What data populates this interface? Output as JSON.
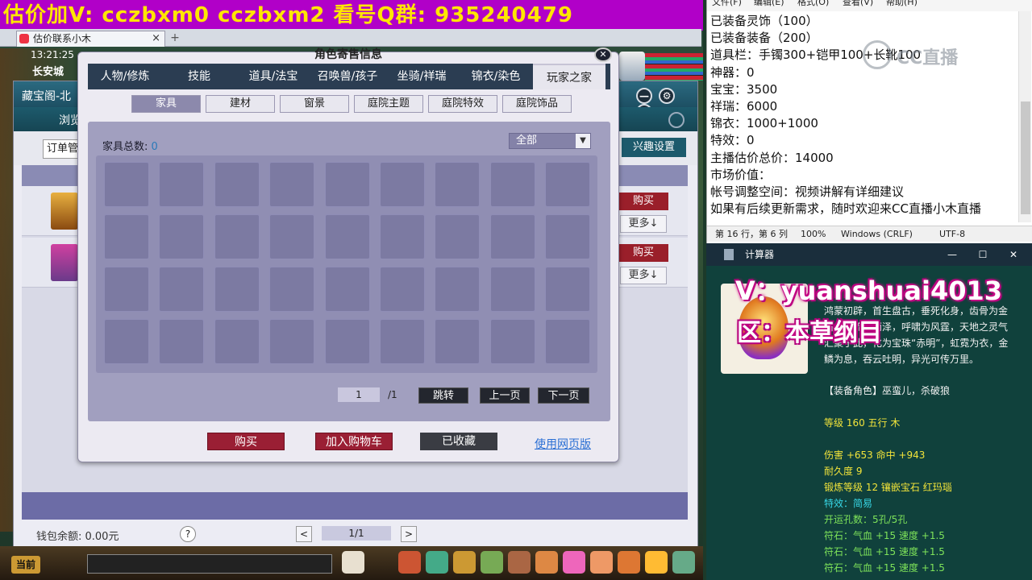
{
  "banner": {
    "text": "估价加V:    cczbxm0    cczbxm2    看号Q群: 935240479"
  },
  "browser": {
    "tab_title": "估价联系小木",
    "tab_close": "×",
    "tab_add": "+"
  },
  "hud": {
    "time": "13:21:25",
    "city": "长安城"
  },
  "store": {
    "title": "藏宝阁-北",
    "nav_browse": "浏览",
    "order_button": "订单管",
    "interest_button": "兴趣设置",
    "rows": [
      {
        "buy": "购买",
        "more": "更多↓"
      },
      {
        "buy": "购买",
        "more": "更多↓"
      }
    ],
    "wallet": "钱包余额: 0.00元",
    "help": "?",
    "pager": {
      "prev": "<",
      "value": "1/1",
      "next": ">"
    },
    "window_controls": {
      "min": "—",
      "settings": "⚙",
      "close": "✕"
    }
  },
  "dialog": {
    "title": "角色寄售信息",
    "close": "✕",
    "tabs": [
      {
        "label": "人物/修炼",
        "active": false
      },
      {
        "label": "技能",
        "active": false
      },
      {
        "label": "道具/法宝",
        "active": false
      },
      {
        "label": "召唤兽/孩子",
        "active": false
      },
      {
        "label": "坐骑/祥瑞",
        "active": false
      },
      {
        "label": "锦衣/染色",
        "active": false
      },
      {
        "label": "玩家之家",
        "active": true
      }
    ],
    "subtabs": [
      {
        "label": "家具",
        "active": true
      },
      {
        "label": "建材",
        "active": false
      },
      {
        "label": "窗景",
        "active": false
      },
      {
        "label": "庭院主题",
        "active": false
      },
      {
        "label": "庭院特效",
        "active": false
      },
      {
        "label": "庭院饰品",
        "active": false
      }
    ],
    "count_label": "家具总数:",
    "count_value": "0",
    "filter_value": "全部",
    "page_input": "1",
    "page_total": "/1",
    "jump_button": "跳转",
    "prev_button": "上一页",
    "next_button": "下一页",
    "buy_button": "购买",
    "cart_button": "加入购物车",
    "collected_button": "已收藏",
    "web_link": "使用网页版"
  },
  "bottom_bar": {
    "current_button": "当前"
  },
  "notepad": {
    "menu": [
      "文件(F)",
      "编辑(E)",
      "格式(O)",
      "查看(V)",
      "帮助(H)"
    ],
    "lines": [
      "已装备灵饰（100）",
      "已装备装备（200）",
      "道具栏：手镯300+铠甲100+长靴100",
      "神器：0",
      "宝宝：3500",
      "祥瑞：6000",
      "锦衣：1000+1000",
      "特效：0",
      "主播估价总价：14000",
      "市场价值：",
      "帐号调整空间：视频讲解有详细建议",
      "如果有后续更新需求，随时欢迎来CC直播小木直播"
    ],
    "status": {
      "position": "第 16 行，第 6 列",
      "zoom": "100%",
      "eol": "Windows (CRLF)",
      "encoding": "UTF-8"
    },
    "watermark": "CC直播"
  },
  "calculator": {
    "label": "计算器",
    "min": "—",
    "max": "☐",
    "close": "✕"
  },
  "item": {
    "overlay_v": "V：yuanshuai4013",
    "overlay_qu": "区：本草纲目",
    "desc": "鸿蒙初辟，首生盘古，垂死化身，齿骨为金石，汗流为雨泽，呼啸为风霆，天地之灵气汇聚于此，化为宝珠“赤明”，虹霓为衣，金鳞为息，吞云吐明，异光可传万里。",
    "role": "【装备角色】巫蛮儿，杀破狼",
    "level": "等级 160  五行 木",
    "damage": "伤害 +653  命中 +943",
    "durability": "耐久度 9",
    "forge": "锻炼等级 12  镶嵌宝石 红玛瑙",
    "special": "特效：简易",
    "holes": "开运孔数：5孔/5孔",
    "runes": [
      "符石：气血 +15  速度 +1.5",
      "符石：气血 +15  速度 +1.5",
      "符石：气血 +15  速度 +1.5"
    ]
  },
  "colors": {
    "banner_bg": "#b100c8",
    "banner_text": "#ffe600",
    "dialog_tab_bg": "#2b3d52",
    "buy_red": "#9a1f34",
    "item_panel_bg": "#10413c"
  }
}
